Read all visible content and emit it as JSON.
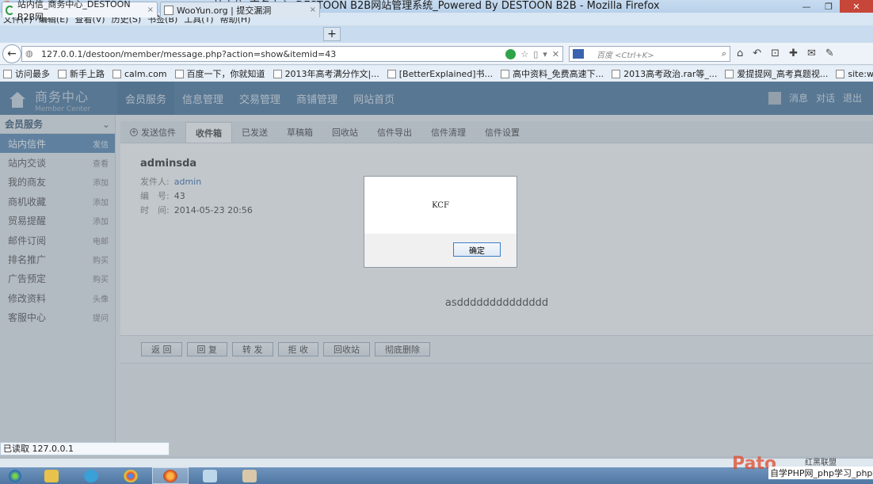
{
  "window": {
    "title": "站内信_商务中心_DESTOON B2B网站管理系统_Powered By DESTOON B2B - Mozilla Firefox",
    "min": "—",
    "max": "❐",
    "close": "✕"
  },
  "menu": [
    "文件(F)",
    "编辑(E)",
    "查看(V)",
    "历史(S)",
    "书签(B)",
    "工具(T)",
    "帮助(H)"
  ],
  "tabs": [
    {
      "label": "站内信_商务中心_DESTOON B2B网...",
      "close": "×"
    },
    {
      "label": "WooYun.org | 提交漏洞",
      "close": "×"
    }
  ],
  "newtab": "+",
  "nav": {
    "back": "←",
    "url": "127.0.0.1/destoon/member/message.php?action=show&itemid=43",
    "search_placeholder": "百度 <Ctrl+K>",
    "search_icon": "magnifier-icon"
  },
  "bookmarks": [
    "访问最多",
    "新手上路",
    "calm.com",
    "百度一下，你就知道",
    "2013年高考满分作文|...",
    "[BetterExplained]书...",
    "高中资料_免费高速下...",
    "2013高考政治.rar等_...",
    "爱提提网_高考真题视...",
    "site:www.wooyun.or..."
  ],
  "site": {
    "logo_cn": "商务中心",
    "logo_en": "Member Center",
    "nav": [
      "会员服务",
      "信息管理",
      "交易管理",
      "商铺管理",
      "网站首页"
    ],
    "right": [
      "消息",
      "对话",
      "退出"
    ]
  },
  "sidebar": {
    "head": "会员服务",
    "items": [
      {
        "label": "站内信件",
        "action": "发信"
      },
      {
        "label": "站内交谈",
        "action": "查看"
      },
      {
        "label": "我的商友",
        "action": "添加"
      },
      {
        "label": "商机收藏",
        "action": "添加"
      },
      {
        "label": "贸易提醒",
        "action": "添加"
      },
      {
        "label": "邮件订阅",
        "action": "电邮"
      },
      {
        "label": "排名推广",
        "action": "购买"
      },
      {
        "label": "广告预定",
        "action": "购买"
      },
      {
        "label": "修改资料",
        "action": "头像"
      },
      {
        "label": "客服中心",
        "action": "提问"
      }
    ]
  },
  "content_tabs": [
    "发送信件",
    "收件箱",
    "已发送",
    "草稿箱",
    "回收站",
    "信件导出",
    "信件清理",
    "信件设置"
  ],
  "message": {
    "title": "adminsda",
    "sender_label": "发件人:",
    "sender": "admin",
    "id_label": "编　号:",
    "id": "43",
    "time_label": "时　间:",
    "time": "2014-05-23 20:56",
    "body": "asdddddddddddddd"
  },
  "actions": [
    "返 回",
    "回 复",
    "转 发",
    "拒 收",
    "回收站",
    "彻底删除"
  ],
  "dialog": {
    "text": "KCF",
    "ok": "确定"
  },
  "status": "已读取 127.0.0.1",
  "watermark": {
    "text": "自学PHP网_php学习_php教",
    "logo": "Pato",
    "union": "红黑联盟"
  }
}
